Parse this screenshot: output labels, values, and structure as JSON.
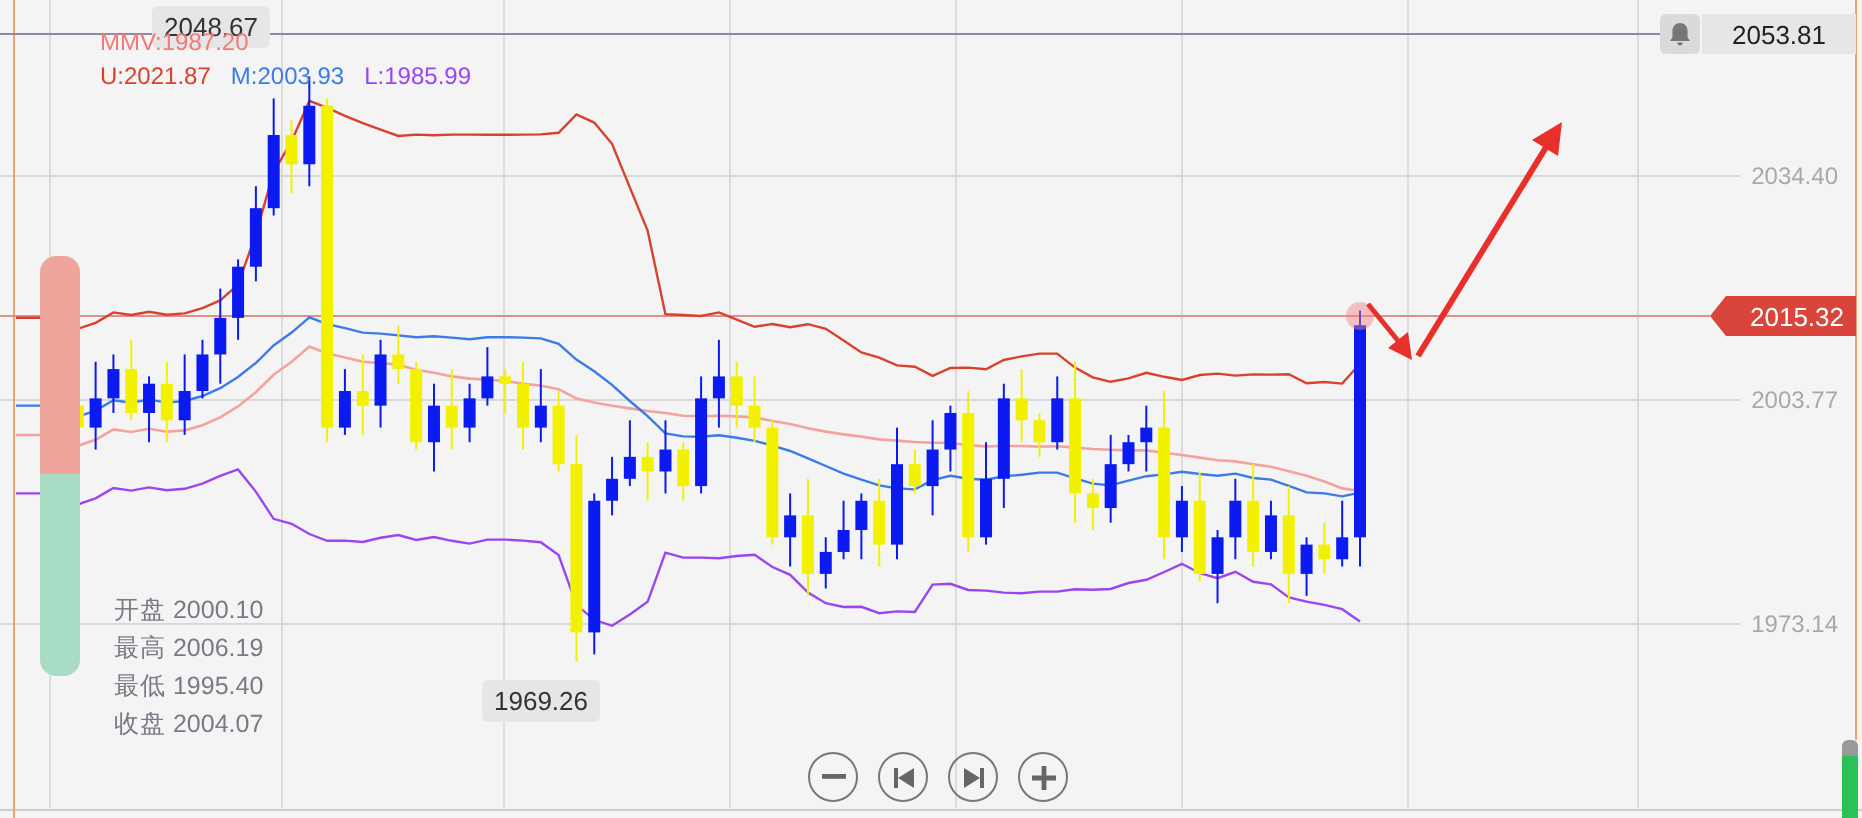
{
  "high_marker": "2048.67",
  "indicators": [
    {
      "kind": "mmv",
      "text": "MMV:1987.20"
    },
    {
      "kind": "upper",
      "text": "U:2021.87"
    },
    {
      "kind": "middle",
      "text": "M:2003.93"
    },
    {
      "kind": "lower",
      "text": "L:1985.99"
    }
  ],
  "price_scale": {
    "alert_price": "2053.81",
    "ticks": [
      "2034.40",
      "2003.77",
      "1973.14"
    ],
    "current_price": "2015.32"
  },
  "ohlc": [
    {
      "label": "开盘",
      "value": "2000.10"
    },
    {
      "label": "最高",
      "value": "2006.19"
    },
    {
      "label": "最低",
      "value": "1995.40"
    },
    {
      "label": "收盘",
      "value": "2004.07"
    }
  ],
  "low_marker": "1969.26",
  "controls": [
    {
      "kind": "zoom-out"
    },
    {
      "kind": "previous"
    },
    {
      "kind": "next"
    },
    {
      "kind": "zoom-in"
    }
  ]
}
